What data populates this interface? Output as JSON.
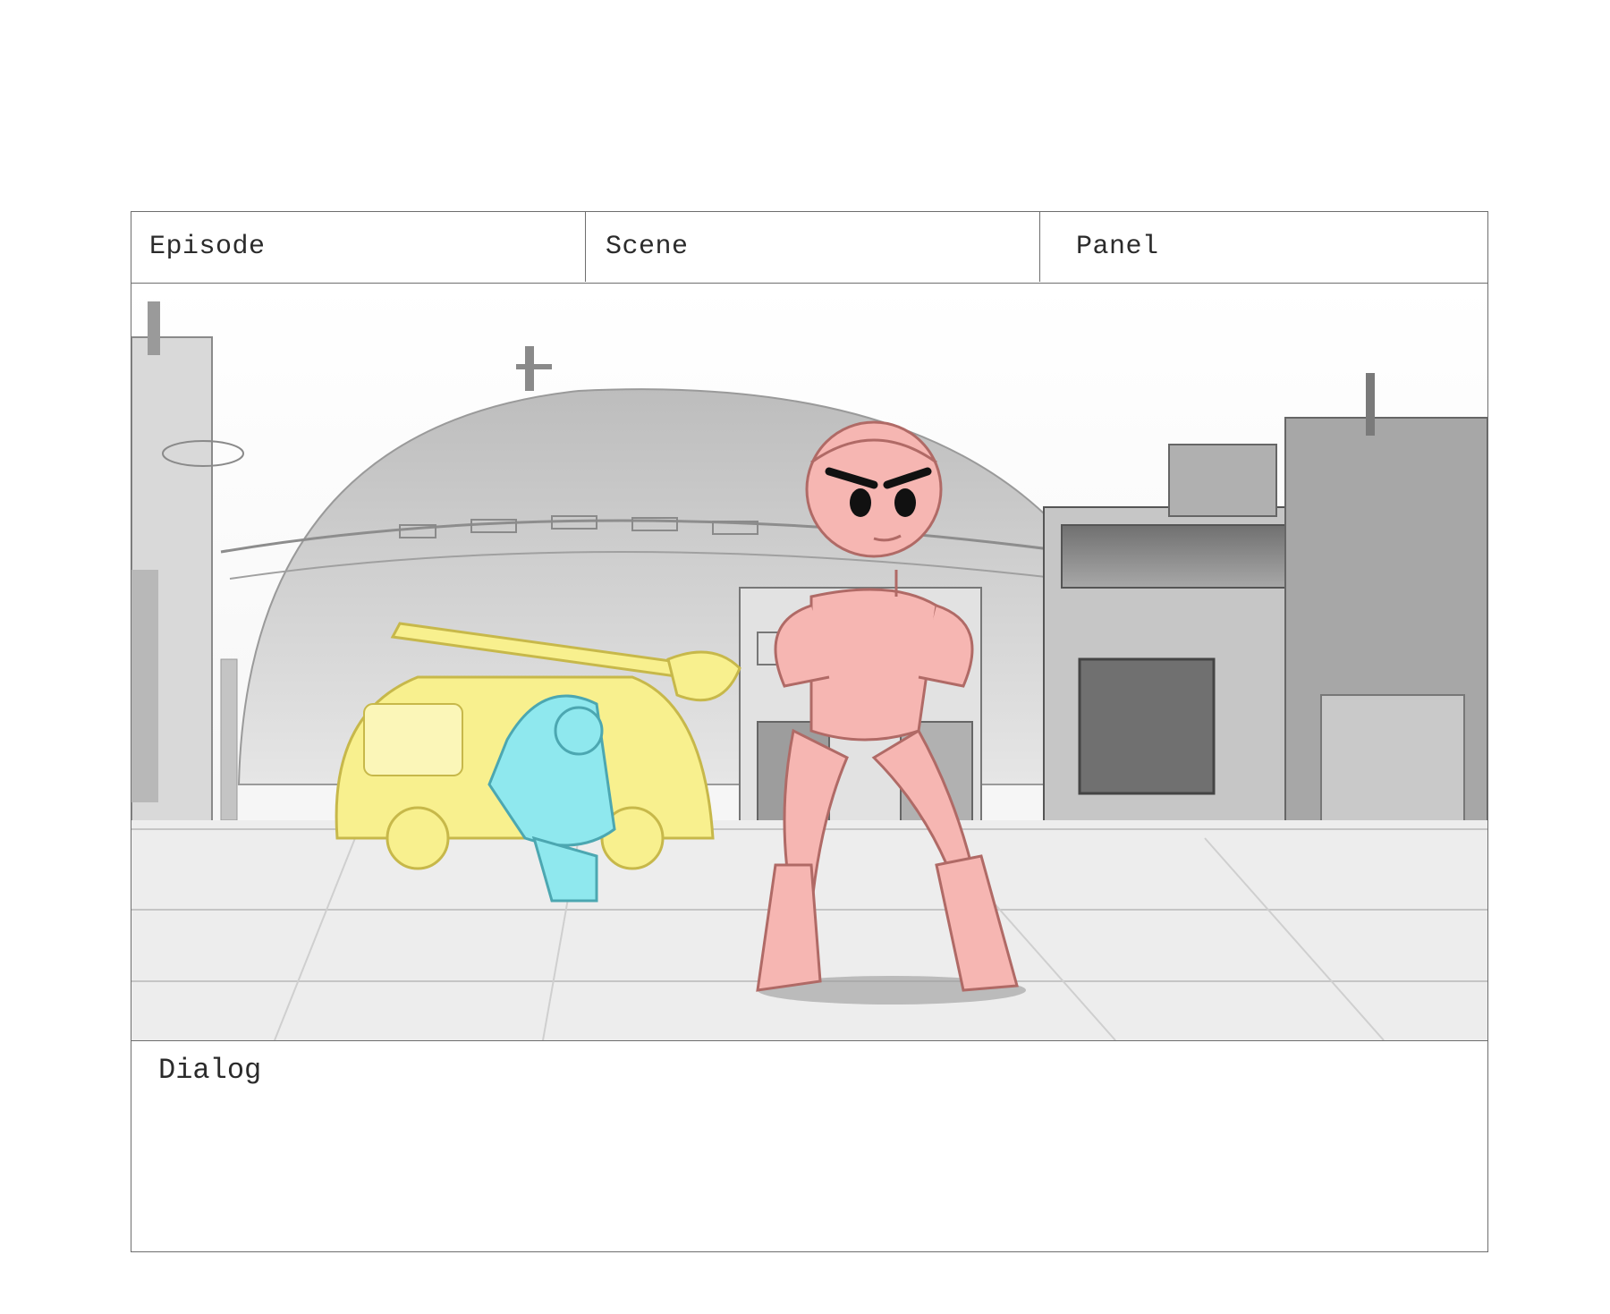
{
  "header": {
    "episode_label": "Episode",
    "scene_label": "Scene",
    "panel_label": "Panel"
  },
  "panel_image": {
    "subject": "storyboard sketch: confident pink heroine with hands on hips, blue hooded figure leaning on yellow van, grey city buildings and dome in background",
    "colors": {
      "heroine": "#f6b6b2",
      "hooded_figure": "#8fe8ee",
      "van": "#f8f08e",
      "background": "#cfcfcf"
    }
  },
  "dialog": {
    "label": "Dialog",
    "text": ""
  }
}
